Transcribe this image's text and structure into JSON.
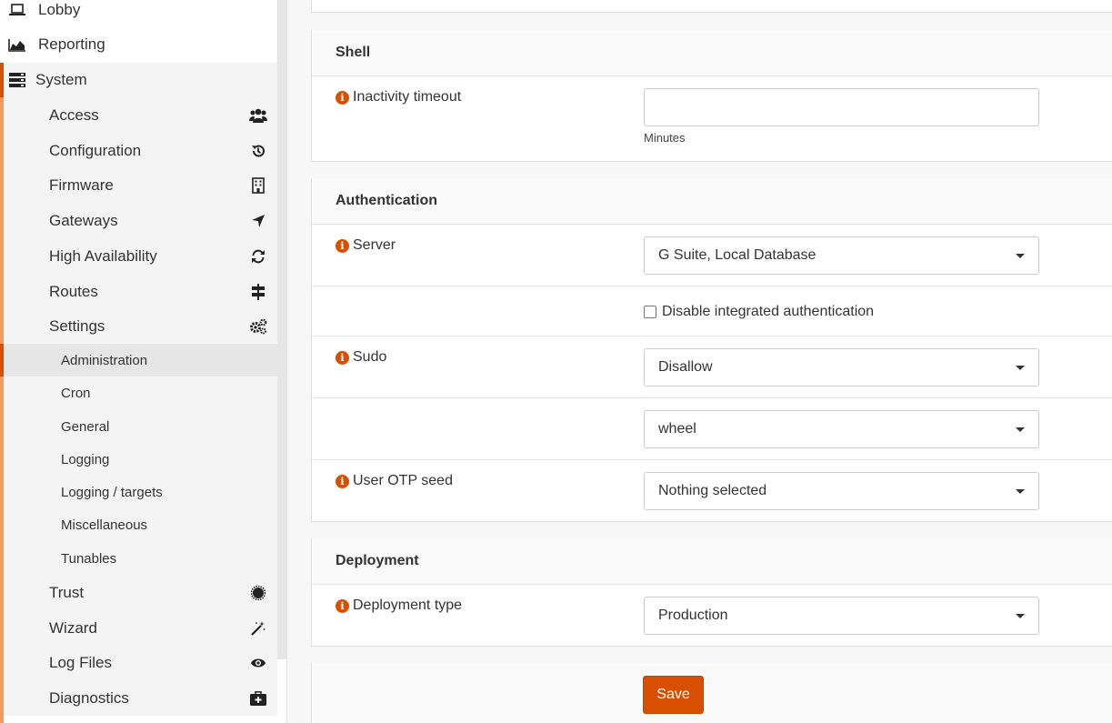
{
  "sidebar": {
    "top_items": [
      {
        "label": "Lobby",
        "icon": "laptop-icon"
      },
      {
        "label": "Reporting",
        "icon": "area-chart-icon"
      },
      {
        "label": "System",
        "icon": "server-icon"
      }
    ],
    "system_items": [
      {
        "label": "Access",
        "icon": "users-icon"
      },
      {
        "label": "Configuration",
        "icon": "history-icon"
      },
      {
        "label": "Firmware",
        "icon": "building-icon"
      },
      {
        "label": "Gateways",
        "icon": "location-arrow-icon"
      },
      {
        "label": "High Availability",
        "icon": "refresh-icon"
      },
      {
        "label": "Routes",
        "icon": "signpost-icon"
      },
      {
        "label": "Settings",
        "icon": "cogs-icon"
      }
    ],
    "settings_items": [
      {
        "label": "Administration"
      },
      {
        "label": "Cron"
      },
      {
        "label": "General"
      },
      {
        "label": "Logging"
      },
      {
        "label": "Logging / targets"
      },
      {
        "label": "Miscellaneous"
      },
      {
        "label": "Tunables"
      }
    ],
    "bottom_items": [
      {
        "label": "Trust",
        "icon": "certificate-icon"
      },
      {
        "label": "Wizard",
        "icon": "magic-icon"
      },
      {
        "label": "Log Files",
        "icon": "eye-icon"
      },
      {
        "label": "Diagnostics",
        "icon": "medkit-icon"
      }
    ]
  },
  "shell": {
    "title": "Shell",
    "inactivity_label": "Inactivity timeout",
    "inactivity_value": "",
    "inactivity_hint": "Minutes"
  },
  "authentication": {
    "title": "Authentication",
    "server_label": "Server",
    "server_value": "G Suite, Local Database",
    "disable_integrated_label": "Disable integrated authentication",
    "sudo_label": "Sudo",
    "sudo_value": "Disallow",
    "sudo_group_value": "wheel",
    "otp_label": "User OTP seed",
    "otp_value": "Nothing selected"
  },
  "deployment": {
    "title": "Deployment",
    "type_label": "Deployment type",
    "type_value": "Production"
  },
  "actions": {
    "save_label": "Save"
  },
  "colors": {
    "accent": "#d94f00",
    "accent_light": "#f39a5d"
  }
}
